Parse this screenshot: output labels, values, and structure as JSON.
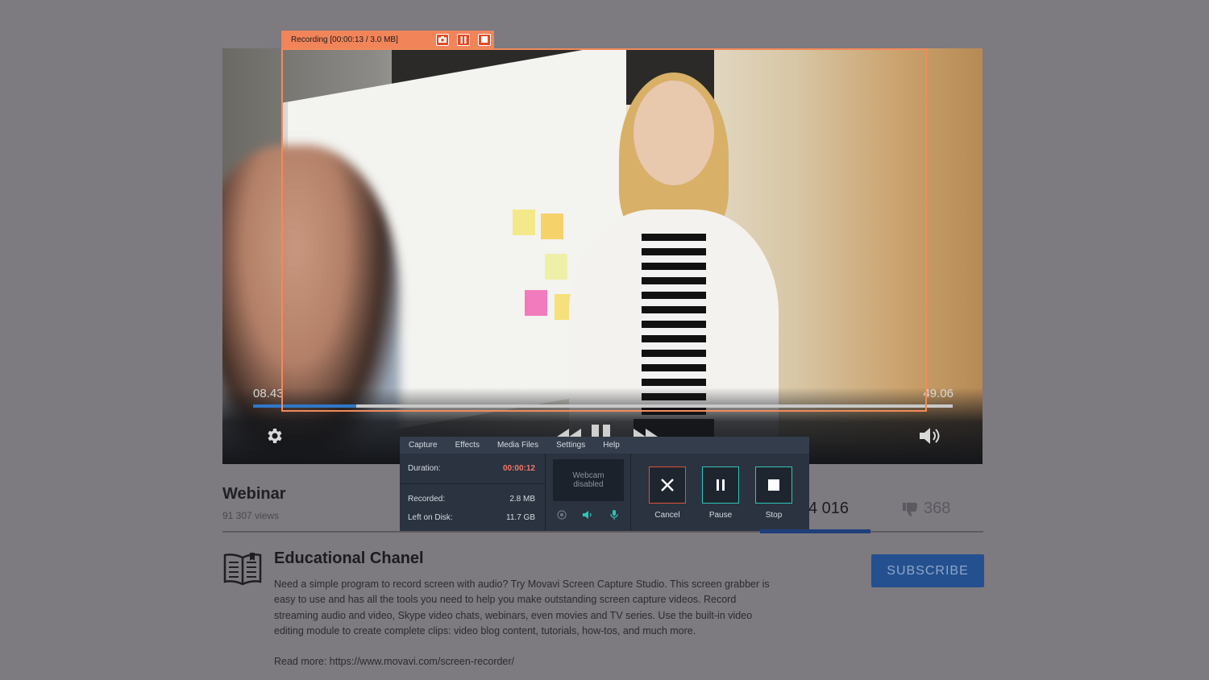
{
  "player": {
    "time_elapsed": "08.43",
    "time_total": "49.06",
    "progress_fraction": 0.148
  },
  "recording_bar": {
    "label": "Recording [00:00:13 / 3.0 MB]",
    "buttons": [
      "camera-icon",
      "pause-icon",
      "stop-icon"
    ]
  },
  "recorder": {
    "menu": [
      "Capture",
      "Effects",
      "Media Files",
      "Settings",
      "Help"
    ],
    "duration_label": "Duration:",
    "duration_value": "00:00:12",
    "recorded_label": "Recorded:",
    "recorded_value": "2.8 MB",
    "disk_label": "Left on Disk:",
    "disk_value": "11.7 GB",
    "webcam_text_line1": "Webcam",
    "webcam_text_line2": "disabled",
    "cancel_label": "Cancel",
    "pause_label": "Pause",
    "stop_label": "Stop",
    "accent_color": "#2fc4b8",
    "cancel_color": "#e0503c"
  },
  "video": {
    "title": "Webinar",
    "views": "91 307 views",
    "likes": "4 016",
    "dislikes": "368"
  },
  "channel": {
    "name": "Educational Chanel",
    "description": "Need a simple program to record screen with audio? Try Movavi Screen Capture Studio. This screen grabber is easy to use and has all the tools you need to help you make outstanding screen capture videos. Record streaming audio and video, Skype video chats, webinars, even movies and TV series. Use the built-in video editing module to create complete clips: video blog content, tutorials, how-tos, and much more.",
    "read_more": "Read more: https://www.movavi.com/screen-recorder/",
    "subscribe_label": "SUBSCRIBE"
  }
}
